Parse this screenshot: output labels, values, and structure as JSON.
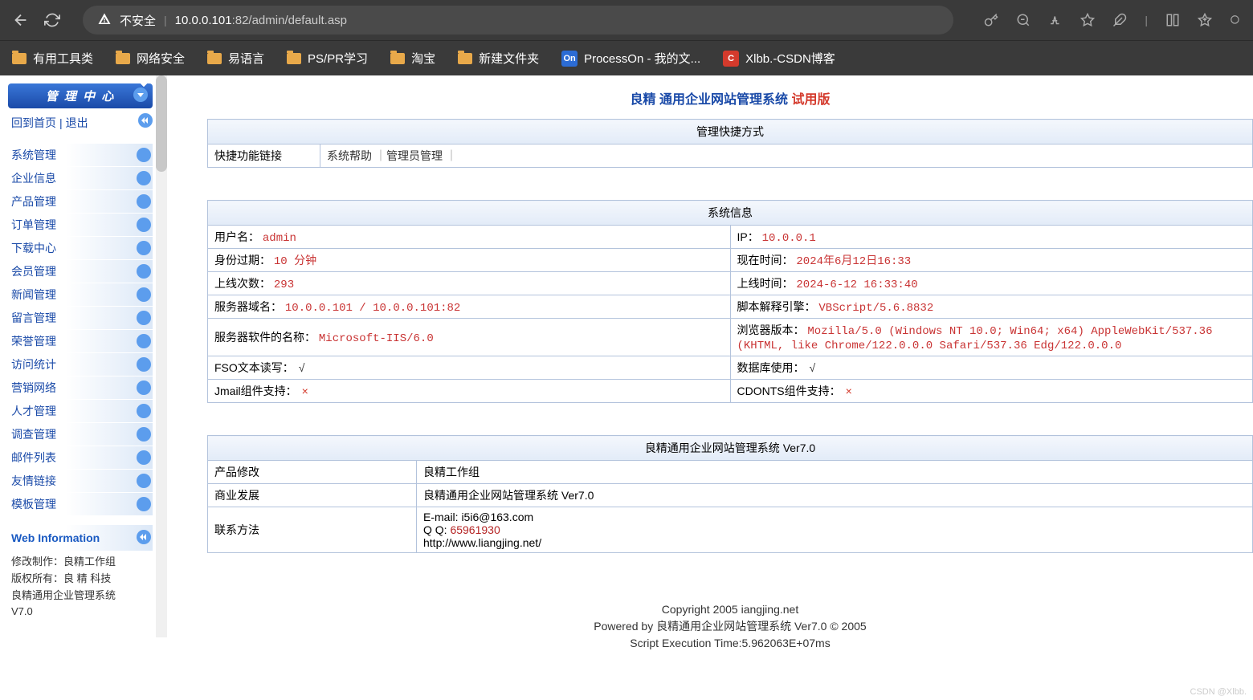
{
  "browser": {
    "security_label": "不安全",
    "url_host": "10.0.0.101",
    "url_port": ":82",
    "url_path": "/admin/default.asp"
  },
  "bookmarks": [
    {
      "type": "folder",
      "label": "有用工具类"
    },
    {
      "type": "folder",
      "label": "网络安全"
    },
    {
      "type": "folder",
      "label": "易语言"
    },
    {
      "type": "folder",
      "label": "PS/PR学习"
    },
    {
      "type": "folder",
      "label": "淘宝"
    },
    {
      "type": "folder",
      "label": "新建文件夹"
    },
    {
      "type": "app",
      "icon": "On",
      "icon_bg": "on-icon",
      "label": "ProcessOn - 我的文..."
    },
    {
      "type": "app",
      "icon": "C",
      "icon_bg": "c-icon",
      "label": "Xlbb.-CSDN博客"
    }
  ],
  "sidebar": {
    "header": "管 理 中 心",
    "home": "回到首页",
    "logout": "退出",
    "menu": [
      "系统管理",
      "企业信息",
      "产品管理",
      "订单管理",
      "下载中心",
      "会员管理",
      "新闻管理",
      "留言管理",
      "荣誉管理",
      "访问统计",
      "营销网络",
      "人才管理",
      "调查管理",
      "邮件列表",
      "友情链接",
      "模板管理"
    ],
    "webinfo_title": "Web Information",
    "webinfo_lines": [
      "修改制作：良精工作组",
      "版权所有：良 精 科技",
      "良精通用企业管理系统",
      "V7.0"
    ]
  },
  "page": {
    "title_main": "良精 通用企业网站管理系统",
    "title_trial": "试用版"
  },
  "shortcut": {
    "header": "管理快捷方式",
    "label": "快捷功能链接",
    "links": [
      "系统帮助",
      "管理员管理"
    ]
  },
  "sysinfo": {
    "header": "系统信息",
    "rows": [
      {
        "l_label": "用户名：",
        "l_value": "admin",
        "r_label": "IP：",
        "r_value": "10.0.0.1"
      },
      {
        "l_label": "身份过期：",
        "l_value": "10 分钟",
        "r_label": "现在时间：",
        "r_value": "2024年6月12日16:33"
      },
      {
        "l_label": "上线次数：",
        "l_value": "293",
        "r_label": "上线时间：",
        "r_value": "2024-6-12 16:33:40"
      },
      {
        "l_label": "服务器域名：",
        "l_value": "10.0.0.101 / 10.0.0.101:82",
        "r_label": "脚本解释引擎：",
        "r_value": "VBScript/5.6.8832"
      },
      {
        "l_label": "服务器软件的名称：",
        "l_value": "Microsoft-IIS/6.0",
        "r_label": "浏览器版本：",
        "r_value": "Mozilla/5.0 (Windows NT 10.0; Win64; x64) AppleWebKit/537.36 (KHTML, like Chrome/122.0.0.0 Safari/537.36 Edg/122.0.0.0"
      },
      {
        "l_label": "FSO文本读写：",
        "l_mark": "√",
        "r_label": "数据库使用：",
        "r_mark": "√"
      },
      {
        "l_label": "Jmail组件支持：",
        "l_mark": "×",
        "r_label": "CDONTS组件支持：",
        "r_mark": "×"
      }
    ]
  },
  "version": {
    "header": "良精通用企业网站管理系统 Ver7.0",
    "rows": [
      {
        "label": "产品修改",
        "value": "良精工作组"
      },
      {
        "label": "商业发展",
        "value": "良精通用企业网站管理系统 Ver7.0"
      }
    ],
    "contact_label": "联系方法",
    "contact_email": "E-mail: i5i6@163.com",
    "contact_qq_label": "Q Q: ",
    "contact_qq": "65961930",
    "contact_url": "http://www.liangjing.net/"
  },
  "footer": {
    "line1": "Copyright 2005 iangjing.net",
    "line2": "Powered by 良精通用企业网站管理系统 Ver7.0 © 2005",
    "line3": "Script Execution Time:5.962063E+07ms"
  },
  "watermark": "CSDN @Xlbb."
}
